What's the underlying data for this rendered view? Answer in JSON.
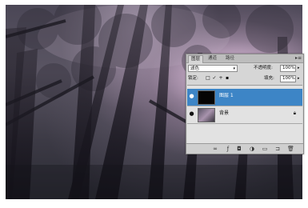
{
  "colors": {
    "panel_bg": "#d6d6d6",
    "selected_layer": "#3d85c6",
    "photo_tint": "#c9a6c9"
  },
  "layers_panel": {
    "tabs": [
      {
        "label": "图层",
        "active": true
      },
      {
        "label": "通道",
        "active": false
      },
      {
        "label": "路径",
        "active": false
      }
    ],
    "menu_icon": "panel-menu-icon",
    "blend_mode": "滤色",
    "opacity_label": "不透明度:",
    "opacity_value": "100%",
    "lock_label": "锁定:",
    "fill_label": "填充:",
    "fill_value": "100%",
    "layers": [
      {
        "name": "图层 1",
        "selected": true,
        "thumbnail": "black",
        "locked": false
      },
      {
        "name": "背景",
        "selected": false,
        "thumbnail": "photo",
        "locked": true
      }
    ],
    "bottom_icons": [
      "link-icon",
      "fx-icon",
      "mask-icon",
      "adjustment-icon",
      "group-icon",
      "new-layer-icon",
      "trash-icon"
    ]
  }
}
